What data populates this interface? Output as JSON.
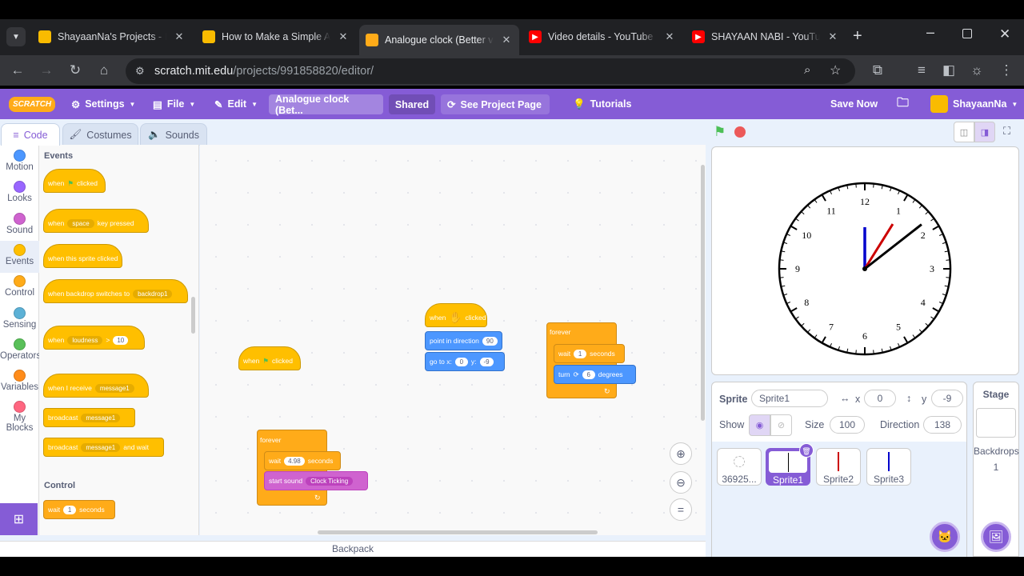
{
  "browser": {
    "tabs": [
      {
        "title": "ShayaanNa's Projects - In",
        "favicon": "scratch-cat",
        "color": "#f9bb00"
      },
      {
        "title": "How to Make a Simple An",
        "favicon": "scratch-cat",
        "color": "#f9bb00"
      },
      {
        "title": "Analogue clock (Better ve",
        "favicon": "scratch-s",
        "color": "#ffab19"
      },
      {
        "title": "Video details - YouTube S",
        "favicon": "youtube",
        "color": "#ff0000"
      },
      {
        "title": "SHAYAAN NABI - YouTub",
        "favicon": "youtube",
        "color": "#ff0000"
      }
    ],
    "url_host": "scratch.mit.edu",
    "url_path": "/projects/991858820/editor/"
  },
  "menubar": {
    "logo": "SCRATCH",
    "settings": "Settings",
    "file": "File",
    "edit": "Edit",
    "project_title": "Analogue clock (Bet...",
    "shared": "Shared",
    "see_project": "See Project Page",
    "tutorials": "Tutorials",
    "save_now": "Save Now",
    "username": "ShayaanNa",
    "accent": "#855cd6"
  },
  "editor_tabs": {
    "code": "Code",
    "costumes": "Costumes",
    "sounds": "Sounds"
  },
  "categories": [
    {
      "label": "Motion",
      "color": "#4c97ff"
    },
    {
      "label": "Looks",
      "color": "#9966ff"
    },
    {
      "label": "Sound",
      "color": "#cf63cf"
    },
    {
      "label": "Events",
      "color": "#ffbf00"
    },
    {
      "label": "Control",
      "color": "#ffab19"
    },
    {
      "label": "Sensing",
      "color": "#5cb1d6"
    },
    {
      "label": "Operators",
      "color": "#59c059"
    },
    {
      "label": "Variables",
      "color": "#ff8c1a"
    },
    {
      "label": "My Blocks",
      "color": "#ff6680"
    }
  ],
  "palette": {
    "events_heading": "Events",
    "control_heading": "Control",
    "when_label": "when",
    "clicked_label": "clicked",
    "space": "space",
    "key_pressed": "key pressed",
    "sprite_clicked": "when this sprite clicked",
    "backdrop_switch": "when backdrop switches to",
    "backdrop1": "backdrop1",
    "loudness": "loudness",
    "gt": ">",
    "ten": "10",
    "receive": "when I receive",
    "message1": "message1",
    "broadcast": "broadcast",
    "and_wait": "and wait",
    "wait": "wait",
    "one": "1",
    "seconds": "seconds"
  },
  "scripts": {
    "when_label": "when",
    "clicked_label": "clicked",
    "point_dir": "point in direction",
    "dir_val": "90",
    "go_to_x": "go to x:",
    "x_val": "0",
    "y_label": "y:",
    "y_val": "-9",
    "forever": "forever",
    "wait": "wait",
    "wait1": "1",
    "seconds": "seconds",
    "turn": "turn",
    "turn_val": "6",
    "degrees": "degrees",
    "wait498": "4.98",
    "start_sound": "start sound",
    "clock_ticking": "Clock Ticking"
  },
  "backpack": "Backpack",
  "sprite_info": {
    "sprite_label": "Sprite",
    "name": "Sprite1",
    "x_label": "x",
    "x": "0",
    "y_label": "y",
    "y": "-9",
    "show_label": "Show",
    "size_label": "Size",
    "size": "100",
    "direction_label": "Direction",
    "direction": "138"
  },
  "sprites": [
    {
      "name": "36925..."
    },
    {
      "name": "Sprite1"
    },
    {
      "name": "Sprite2"
    },
    {
      "name": "Sprite3"
    }
  ],
  "stage_panel": {
    "title": "Stage",
    "backdrops_label": "Backdrops",
    "backdrops_count": "1"
  },
  "clock": {
    "numbers": [
      "12",
      "1",
      "2",
      "3",
      "4",
      "5",
      "6",
      "7",
      "8",
      "9",
      "10",
      "11"
    ],
    "hand_colors": {
      "hour": "#0000cc",
      "minute": "#cc0000",
      "second": "#000000"
    }
  }
}
